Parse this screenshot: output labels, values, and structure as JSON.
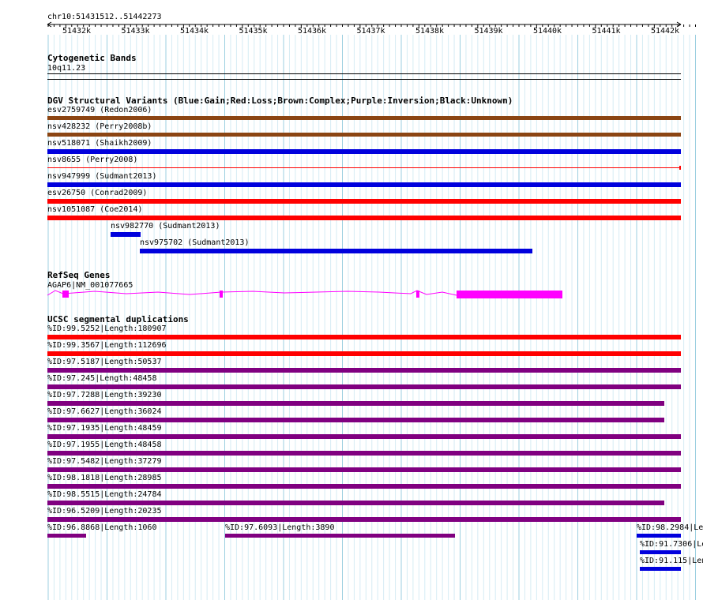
{
  "locus": "chr10:51431512..51442273",
  "ruler": {
    "ticks": [
      "51432k",
      "51433k",
      "51434k",
      "51435k",
      "51436k",
      "51437k",
      "51438k",
      "51439k",
      "51440k",
      "51441k",
      "51442k"
    ]
  },
  "cytoband": {
    "title": "Cytogenetic Bands",
    "band": "10q11.23"
  },
  "dgv": {
    "title": "DGV Structural Variants (Blue:Gain;Red:Loss;Brown:Complex;Purple:Inversion;Black:Unknown)",
    "colors": {
      "gain": "#0000dd",
      "loss": "#ff0000",
      "complex": "#8b4513",
      "inversion": "#800080",
      "unknown": "#000000"
    },
    "items": [
      {
        "label": "esv2759749 (Redon2006)",
        "type": "complex"
      },
      {
        "label": "nsv428232 (Perry2008b)",
        "type": "complex"
      },
      {
        "label": "nsv518071 (Shaikh2009)",
        "type": "gain"
      },
      {
        "label": "nsv8655 (Perry2008)",
        "type": "loss"
      },
      {
        "label": "nsv947999 (Sudmant2013)",
        "type": "gain"
      },
      {
        "label": "esv26750 (Conrad2009)",
        "type": "loss"
      },
      {
        "label": "nsv1051087 (Coe2014)",
        "type": "loss"
      },
      {
        "label": "nsv982770 (Sudmant2013)",
        "type": "gain"
      },
      {
        "label": "nsv975702 (Sudmant2013)",
        "type": "gain"
      }
    ]
  },
  "refseq": {
    "title": "RefSeq Genes",
    "gene_label": "AGAP6|NM_001077665",
    "color": "#ff00ff"
  },
  "segdup": {
    "title": "UCSC segmental duplications",
    "colors": {
      "red": "#ff0000",
      "purple": "#800080",
      "blue": "#0000dd"
    },
    "items": [
      {
        "label": "%ID:99.5252|Length:180907",
        "color": "red"
      },
      {
        "label": "%ID:99.3567|Length:112696",
        "color": "red"
      },
      {
        "label": "%ID:97.5187|Length:50537",
        "color": "purple"
      },
      {
        "label": "%ID:97.245|Length:48458",
        "color": "purple"
      },
      {
        "label": "%ID:97.7288|Length:39230",
        "color": "purple"
      },
      {
        "label": "%ID:97.6627|Length:36024",
        "color": "purple"
      },
      {
        "label": "%ID:97.1935|Length:48459",
        "color": "purple"
      },
      {
        "label": "%ID:97.1955|Length:48458",
        "color": "purple"
      },
      {
        "label": "%ID:97.5482|Length:37279",
        "color": "purple"
      },
      {
        "label": "%ID:98.1818|Length:28985",
        "color": "purple"
      },
      {
        "label": "%ID:98.5515|Length:24784",
        "color": "purple"
      },
      {
        "label": "%ID:96.5209|Length:20235",
        "color": "purple"
      },
      {
        "label": "%ID:96.8868|Length:1060",
        "color": "purple"
      },
      {
        "label": "%ID:97.6093|Length:3890",
        "color": "purple"
      },
      {
        "label": "%ID:98.2984|Le",
        "color": "blue"
      },
      {
        "label": "%ID:91.7306|Le",
        "color": "blue"
      },
      {
        "label": "%ID:91.115|Len",
        "color": "blue"
      }
    ]
  }
}
